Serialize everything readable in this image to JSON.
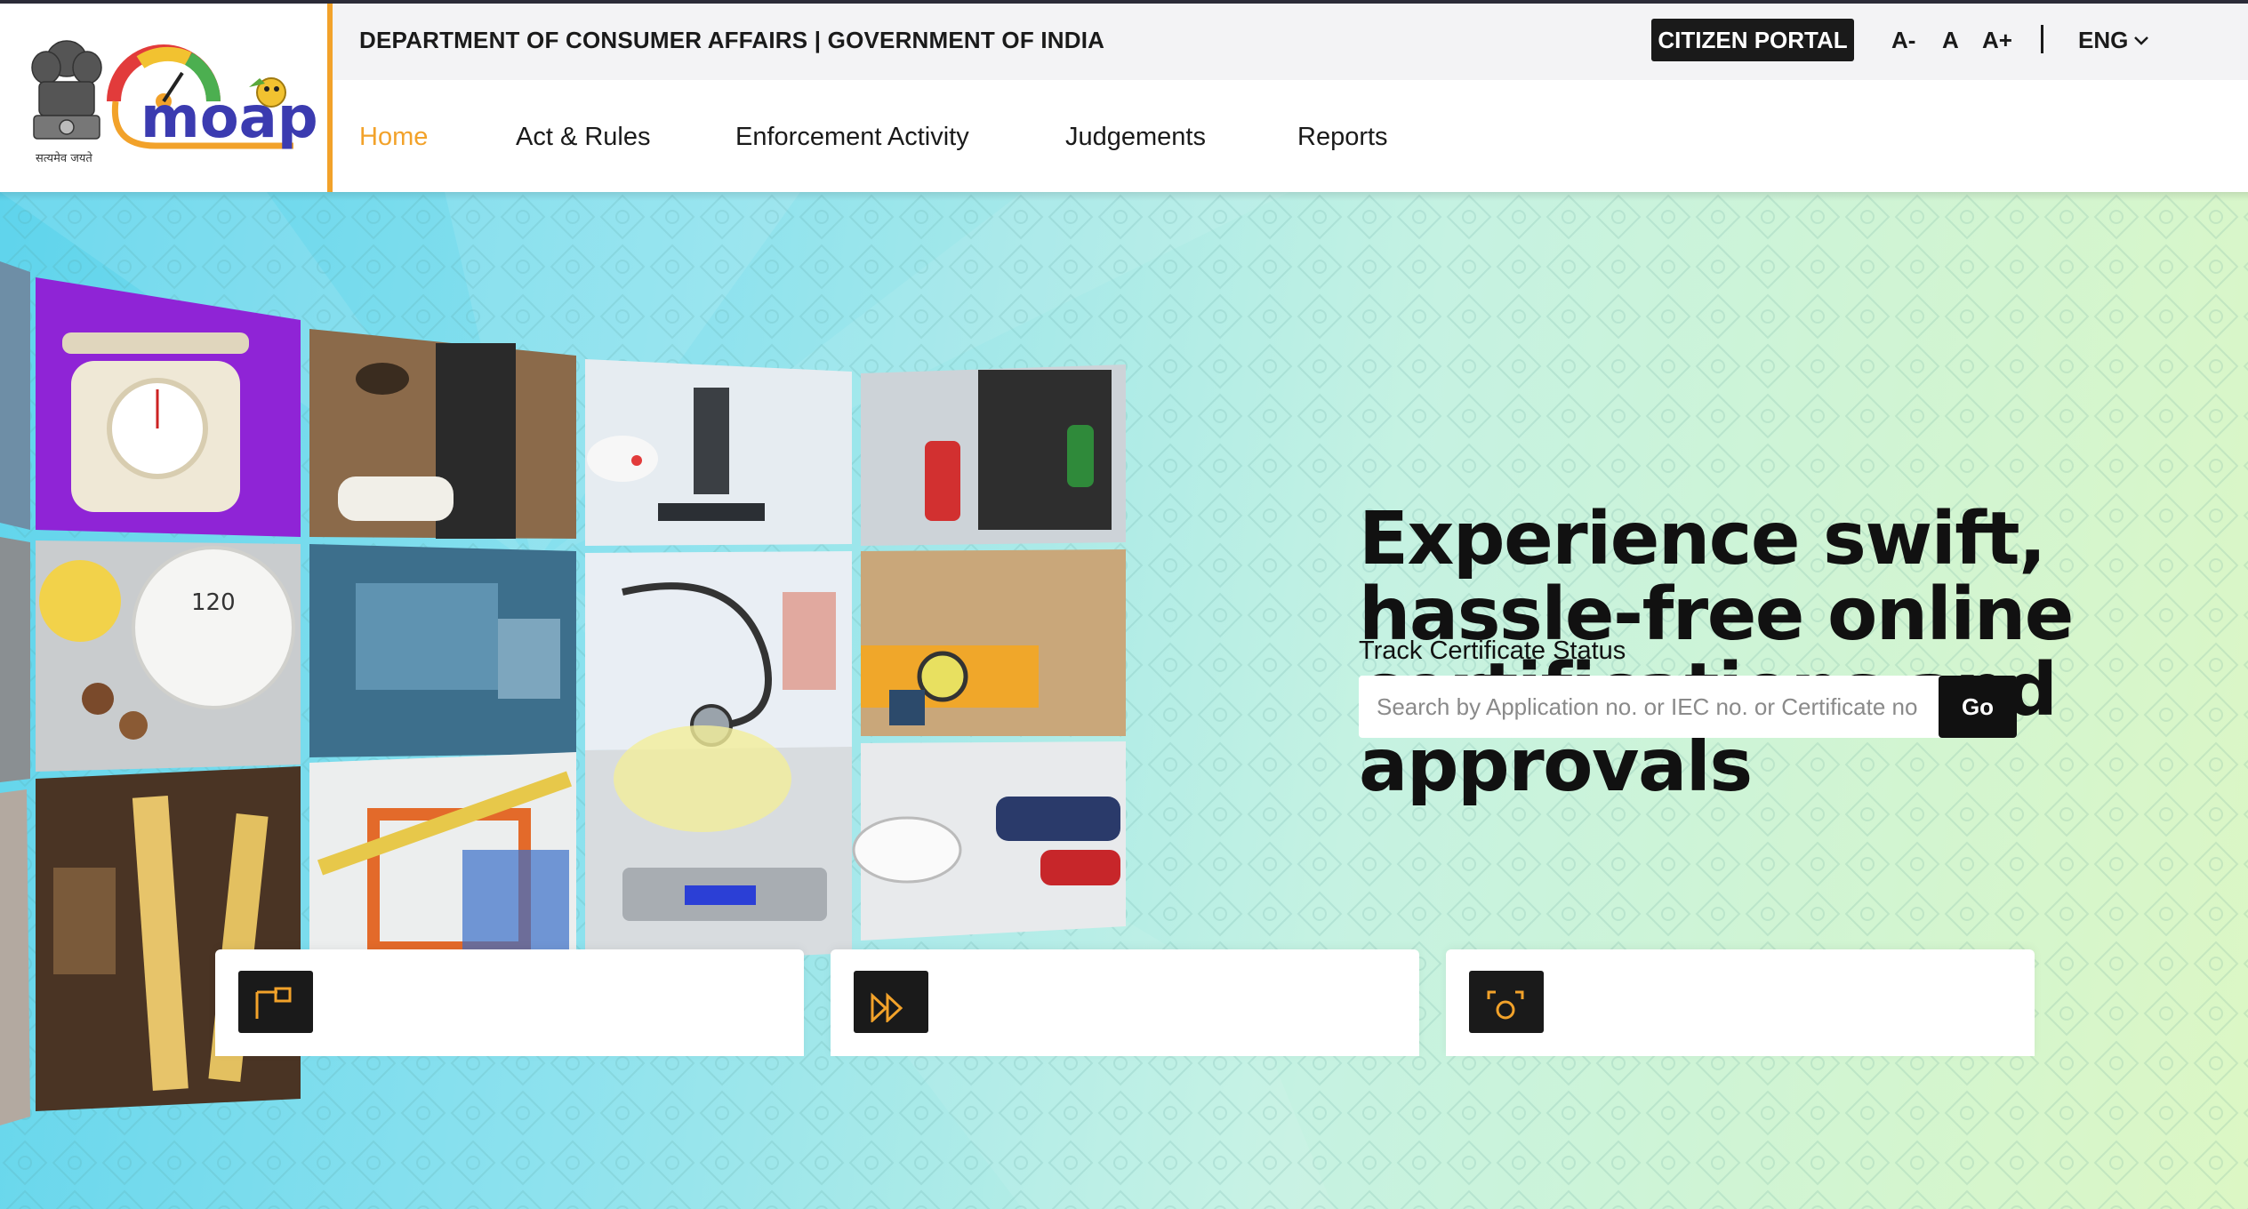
{
  "header": {
    "department": "DEPARTMENT OF CONSUMER AFFAIRS | GOVERNMENT OF INDIA",
    "citizen_portal": "CITIZEN PORTAL",
    "font_controls": [
      "A-",
      "A",
      "A+"
    ],
    "language": "ENG",
    "logo_text": "moap",
    "emblem_motto": "सत्यमेव जयते",
    "emblem_icon": "national-emblem-icon",
    "accent_color": "#f2a22a"
  },
  "nav": {
    "items": [
      {
        "label": "Home",
        "active": true
      },
      {
        "label": "Act & Rules",
        "active": false
      },
      {
        "label": "Enforcement Activity",
        "active": false
      },
      {
        "label": "Judgements",
        "active": false
      },
      {
        "label": "Reports",
        "active": false
      }
    ]
  },
  "hero": {
    "title": "Experience swift, hassle-free online certifications and approvals",
    "track_label": "Track Certificate Status",
    "search_placeholder": "Search by Application no. or IEC no. or Certificate no.",
    "go_label": "Go",
    "collage_tiles": [
      "kitchen-scale-icon",
      "restaurant-service-image",
      "microscope-lab-image",
      "fuel-pump-image",
      "weighing-scale-dial-image",
      "laptop-document-image",
      "stethoscope-image",
      "spirit-level-image",
      "measuring-rulers-image",
      "technical-drawing-image",
      "digital-scale-image",
      "car-showroom-image"
    ]
  },
  "cards": [
    {
      "icon": "application-icon"
    },
    {
      "icon": "fast-forward-icon"
    },
    {
      "icon": "face-scan-icon"
    }
  ],
  "colors": {
    "dark": "#1a1a1a",
    "hero_start": "#5fd4ec",
    "hero_end": "#dcf7c4"
  }
}
